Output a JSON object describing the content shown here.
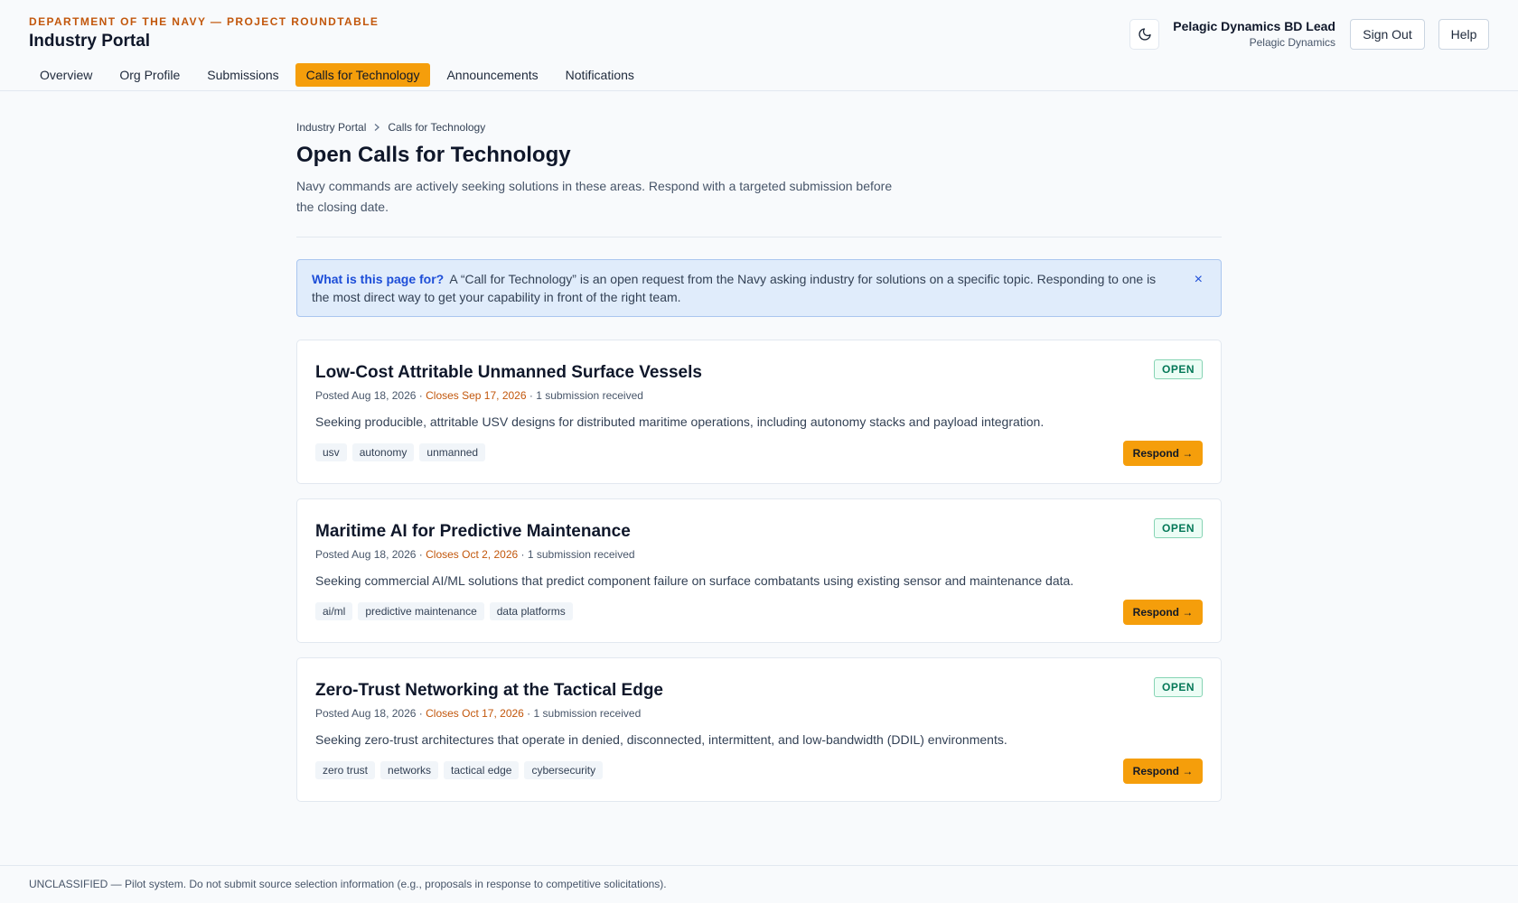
{
  "header": {
    "department": "DEPARTMENT OF THE NAVY — PROJECT ROUNDTABLE",
    "title": "Industry Portal",
    "theme_icon": "moon-icon",
    "user_name": "Pelagic Dynamics BD Lead",
    "user_org": "Pelagic Dynamics",
    "sign_out": "Sign Out",
    "help": "Help"
  },
  "nav": {
    "items": [
      {
        "label": "Overview"
      },
      {
        "label": "Org Profile"
      },
      {
        "label": "Submissions"
      },
      {
        "label": "Calls for Technology",
        "active": true
      },
      {
        "label": "Announcements"
      },
      {
        "label": "Notifications"
      }
    ]
  },
  "breadcrumb": {
    "root": "Industry Portal",
    "current": "Calls for Technology"
  },
  "page": {
    "title": "Open Calls for Technology",
    "description": "Navy commands are actively seeking solutions in these areas. Respond with a targeted submission before the closing date."
  },
  "info": {
    "label": "What is this page for?",
    "text": "A “Call for Technology” is an open request from the Navy asking industry for solutions on a specific topic. Responding to one is the most direct way to get your capability in front of the right team.",
    "close": "×"
  },
  "calls": [
    {
      "title": "Low-Cost Attritable Unmanned Surface Vessels",
      "posted": "Posted Aug 18, 2026",
      "closes": "Closes Sep 17, 2026",
      "submissions": "1 submission received",
      "description": "Seeking producible, attritable USV designs for distributed maritime operations, including autonomy stacks and payload integration.",
      "tags": [
        "usv",
        "autonomy",
        "unmanned"
      ],
      "status": "OPEN",
      "action": "Respond →"
    },
    {
      "title": "Maritime AI for Predictive Maintenance",
      "posted": "Posted Aug 18, 2026",
      "closes": "Closes Oct 2, 2026",
      "submissions": "1 submission received",
      "description": "Seeking commercial AI/ML solutions that predict component failure on surface combatants using existing sensor and maintenance data.",
      "tags": [
        "ai/ml",
        "predictive maintenance",
        "data platforms"
      ],
      "status": "OPEN",
      "action": "Respond →"
    },
    {
      "title": "Zero-Trust Networking at the Tactical Edge",
      "posted": "Posted Aug 18, 2026",
      "closes": "Closes Oct 17, 2026",
      "submissions": "1 submission received",
      "description": "Seeking zero-trust architectures that operate in denied, disconnected, intermittent, and low-bandwidth (DDIL) environments.",
      "tags": [
        "zero trust",
        "networks",
        "tactical edge",
        "cybersecurity"
      ],
      "status": "OPEN",
      "action": "Respond →"
    }
  ],
  "footer": {
    "text": "UNCLASSIFIED — Pilot system. Do not submit source selection information (e.g., proposals in response to competitive solicitations)."
  },
  "colors": {
    "accent": "#f59e0b",
    "dept_text": "#c2570c",
    "info_bg": "#e0ecfb",
    "open_badge": "#047857"
  }
}
